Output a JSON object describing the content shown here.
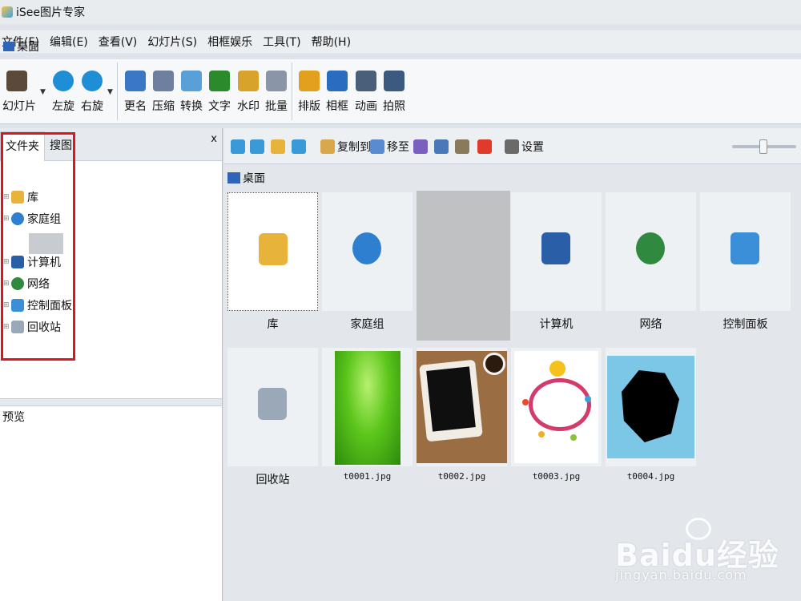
{
  "app": {
    "title": "iSee图片专家"
  },
  "menu": [
    "文件(F)",
    "编辑(E)",
    "查看(V)",
    "幻灯片(S)",
    "相框娱乐",
    "工具(T)",
    "帮助(H)"
  ],
  "toolbar": {
    "items": [
      {
        "label": "幻灯片",
        "icon": "slideshow-icon",
        "color": "#5b4a3a"
      },
      {
        "label": "左旋",
        "icon": "rotate-left-icon",
        "color": "#1e8fd6"
      },
      {
        "label": "右旋",
        "icon": "rotate-right-icon",
        "color": "#1e8fd6"
      },
      {
        "label": "更名",
        "icon": "rename-icon",
        "color": "#3a78c6"
      },
      {
        "label": "压缩",
        "icon": "compress-icon",
        "color": "#6f7fa0"
      },
      {
        "label": "转换",
        "icon": "convert-icon",
        "color": "#5aa0d8"
      },
      {
        "label": "文字",
        "icon": "text-icon",
        "color": "#2b8a2b"
      },
      {
        "label": "水印",
        "icon": "watermark-icon",
        "color": "#d8a32a"
      },
      {
        "label": "批量",
        "icon": "batch-icon",
        "color": "#8a96a8"
      },
      {
        "label": "排版",
        "icon": "layout-icon",
        "color": "#e2a01e"
      },
      {
        "label": "相框",
        "icon": "frame-icon",
        "color": "#2a6cc0"
      },
      {
        "label": "动画",
        "icon": "animation-icon",
        "color": "#4a5f7a"
      },
      {
        "label": "拍照",
        "icon": "camera-icon",
        "color": "#3c5a80"
      }
    ]
  },
  "left": {
    "tabs": [
      "文件夹",
      "搜图"
    ],
    "close": "x",
    "root": "桌面",
    "items": [
      {
        "label": "库",
        "icon": "library-icon",
        "color": "#e8b33a"
      },
      {
        "label": "家庭组",
        "icon": "homegroup-icon",
        "color": "#2f7fd0"
      },
      {
        "label": "计算机",
        "icon": "computer-icon",
        "color": "#2a5fa8"
      },
      {
        "label": "网络",
        "icon": "network-icon",
        "color": "#2f8a3f"
      },
      {
        "label": "控制面板",
        "icon": "control-panel-icon",
        "color": "#3a8fd8"
      },
      {
        "label": "回收站",
        "icon": "recycle-bin-icon",
        "color": "#9aa8b8"
      }
    ],
    "preview_label": "预览"
  },
  "right": {
    "toolbar": {
      "copy_to": "复制到",
      "move_to": "移至",
      "settings": "设置"
    },
    "breadcrumb": "桌面",
    "thumbs": [
      {
        "label": "库",
        "icon": "library-icon",
        "color": "#e8b33a"
      },
      {
        "label": "家庭组",
        "icon": "homegroup-icon",
        "color": "#2f7fd0"
      },
      {
        "label": "计算机",
        "icon": "computer-icon",
        "color": "#2a5fa8"
      },
      {
        "label": "网络",
        "icon": "network-icon",
        "color": "#2f8a3f"
      },
      {
        "label": "控制面板",
        "icon": "control-panel-icon",
        "color": "#3a8fd8"
      },
      {
        "label": "回收站",
        "icon": "recycle-bin-icon",
        "color": "#9aa8b8"
      },
      {
        "label": "t0001.jpg"
      },
      {
        "label": "t0002.jpg"
      },
      {
        "label": "t0003.jpg"
      },
      {
        "label": "t0004.jpg"
      }
    ]
  },
  "watermark": {
    "brand": "Baidu经验",
    "url": "jingyan.baidu.com"
  },
  "colors": {
    "highlight_box": "#e0141c",
    "accent": "#2f64b8"
  }
}
